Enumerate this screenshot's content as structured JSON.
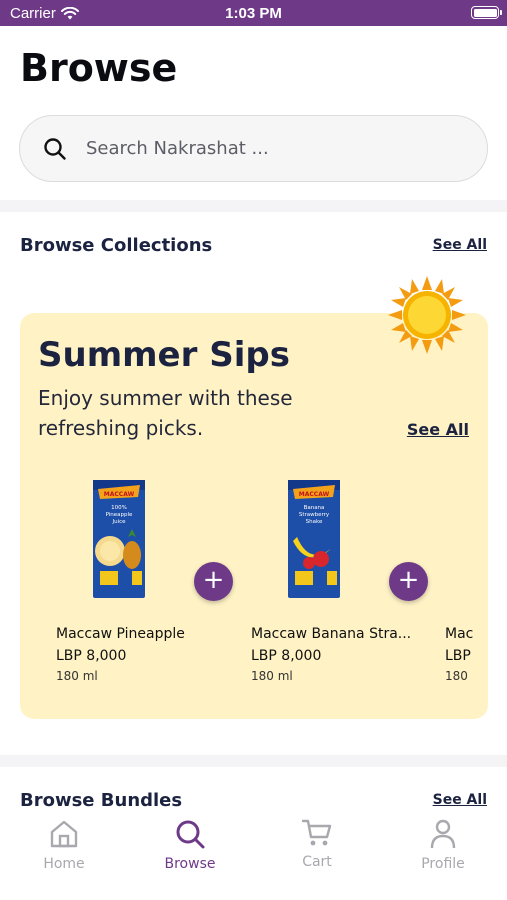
{
  "status_bar": {
    "carrier": "Carrier",
    "time": "1:03 PM"
  },
  "header": {
    "title": "Browse"
  },
  "search": {
    "placeholder": "Search Nakrashat ..."
  },
  "collections_section": {
    "title": "Browse Collections",
    "see_all": "See All"
  },
  "collection": {
    "title": "Summer Sips",
    "subtitle": "Enjoy summer with these refreshing picks.",
    "see_all": "See All",
    "background_color": "#fff3c6",
    "products": [
      {
        "name": "Maccaw Pineapple",
        "price": "LBP 8,000",
        "size": "180 ml",
        "pack_text": "100% Pineapple Juice",
        "brand": "MACCAW"
      },
      {
        "name": "Maccaw Banana Stra...",
        "price": "LBP 8,000",
        "size": "180 ml",
        "pack_text": "Banana Strawberry Shake",
        "brand": "MACCAW"
      },
      {
        "name": "Mac",
        "price": "LBP",
        "size": "180 ",
        "pack_text": "",
        "brand": ""
      }
    ]
  },
  "bundles_section": {
    "title": "Browse Bundles",
    "see_all": "See All"
  },
  "tab_bar": {
    "tabs": [
      {
        "label": "Home",
        "icon": "home-icon",
        "active": false
      },
      {
        "label": "Browse",
        "icon": "search-icon",
        "active": true
      },
      {
        "label": "Cart",
        "icon": "cart-icon",
        "active": false
      },
      {
        "label": "Profile",
        "icon": "profile-icon",
        "active": false
      }
    ]
  },
  "colors": {
    "accent": "#6e3a88",
    "heading": "#1c2340",
    "collection_bg": "#fff3c6",
    "sun": "#f6b400"
  }
}
